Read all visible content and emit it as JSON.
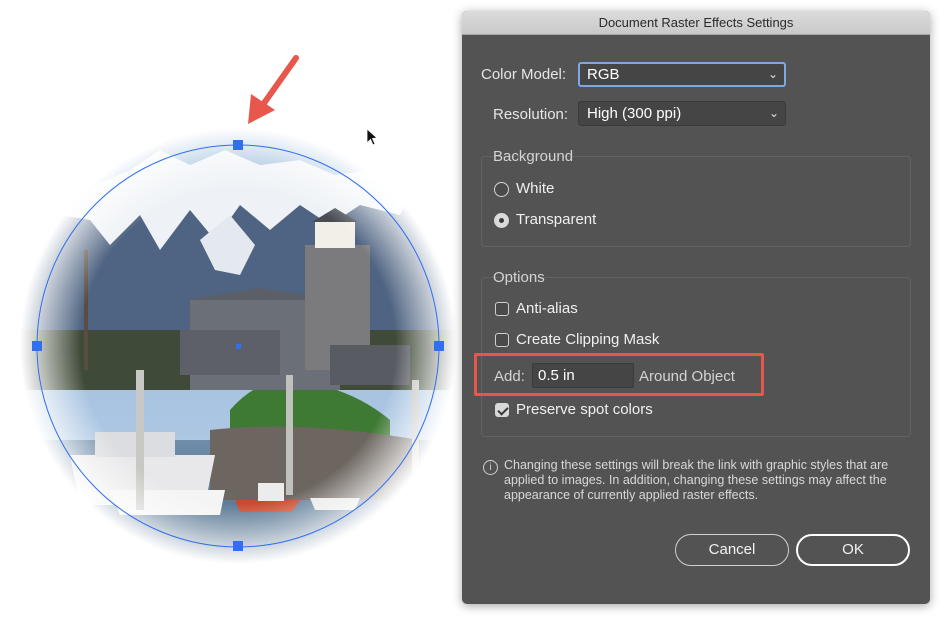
{
  "dialog": {
    "title": "Document Raster Effects Settings",
    "color_model": {
      "label": "Color Model:",
      "value": "RGB"
    },
    "resolution": {
      "label": "Resolution:",
      "value": "High (300 ppi)"
    },
    "background": {
      "title": "Background",
      "options": [
        {
          "label": "White",
          "selected": false
        },
        {
          "label": "Transparent",
          "selected": true
        }
      ]
    },
    "options": {
      "title": "Options",
      "anti_alias": {
        "label": "Anti-alias",
        "checked": false
      },
      "clipping_mask": {
        "label": "Create Clipping Mask",
        "checked": false
      },
      "add": {
        "label": "Add:",
        "value": "0.5 in",
        "suffix": "Around Object"
      },
      "preserve_spot": {
        "label": "Preserve spot colors",
        "checked": true
      }
    },
    "info": "Changing these settings will break the link with graphic styles that are applied to images. In addition, changing these settings may affect the appearance of currently applied raster effects.",
    "buttons": {
      "cancel": "Cancel",
      "ok": "OK"
    }
  },
  "annotation_color": "#e8574c",
  "selection_color": "#2f6ff0",
  "icons": [
    "arrow-annotation",
    "mouse-cursor-icon",
    "chevron-down-icon",
    "info-icon"
  ]
}
